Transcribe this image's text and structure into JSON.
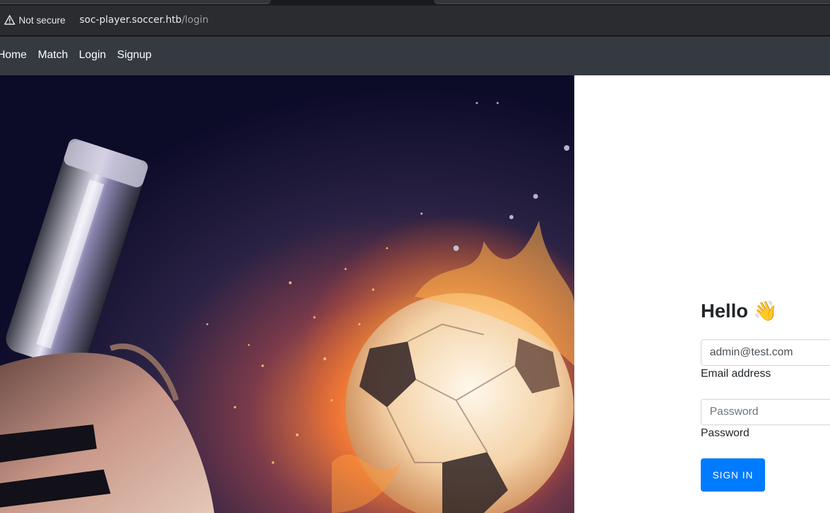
{
  "browser": {
    "security_label": "Not secure",
    "url_host": "soc-player.soccer.htb",
    "url_path": "/login"
  },
  "navbar": {
    "links": [
      "Home",
      "Match",
      "Login",
      "Signup"
    ]
  },
  "login": {
    "greeting": "Hello 👋",
    "email_value": "admin@test.com",
    "email_label": "Email address",
    "password_placeholder": "Password",
    "password_label": "Password",
    "signin_label": "SIGN IN"
  },
  "colors": {
    "navbar_bg": "#343a40",
    "primary_button": "#007bff"
  }
}
